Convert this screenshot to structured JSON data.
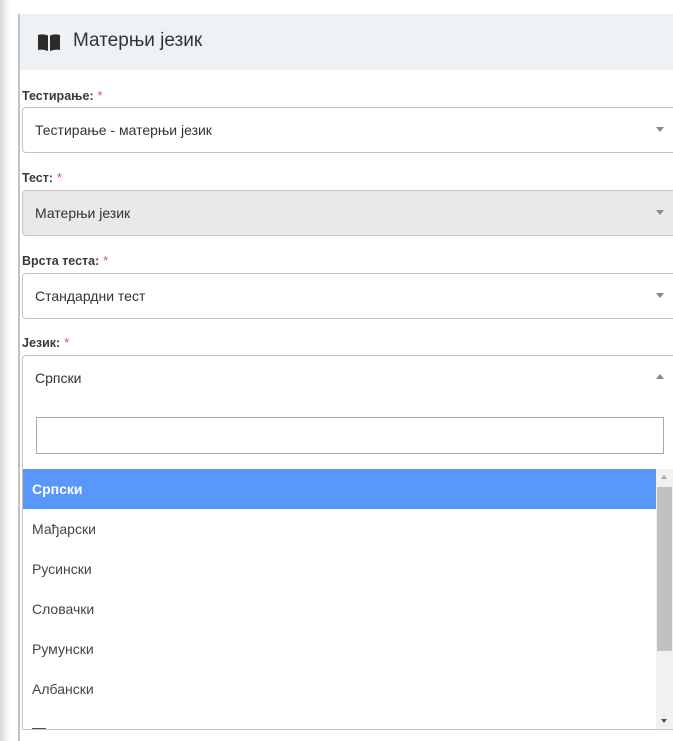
{
  "header": {
    "title": "Матерњи језик",
    "icon": "book-icon"
  },
  "fields": [
    {
      "label": "Тестирање:",
      "required": "*",
      "value": "Тестирање - матерњи језик",
      "disabled": false
    },
    {
      "label": "Тест:",
      "required": "*",
      "value": "Матерњи језик",
      "disabled": true
    },
    {
      "label": "Врста теста:",
      "required": "*",
      "value": "Стандардни тест",
      "disabled": false
    },
    {
      "label": "Језик:",
      "required": "*",
      "value": "Српски",
      "open": true
    }
  ],
  "dropdown": {
    "search_value": "",
    "options": [
      "Српски",
      "Мађарски",
      "Русински",
      "Словачки",
      "Румунски",
      "Албански"
    ],
    "selected_index": 0,
    "selected_color": "#5897fb"
  },
  "colors": {
    "accent": "#5897fb",
    "required": "#d9534f",
    "header_bg": "#eef2f5"
  }
}
